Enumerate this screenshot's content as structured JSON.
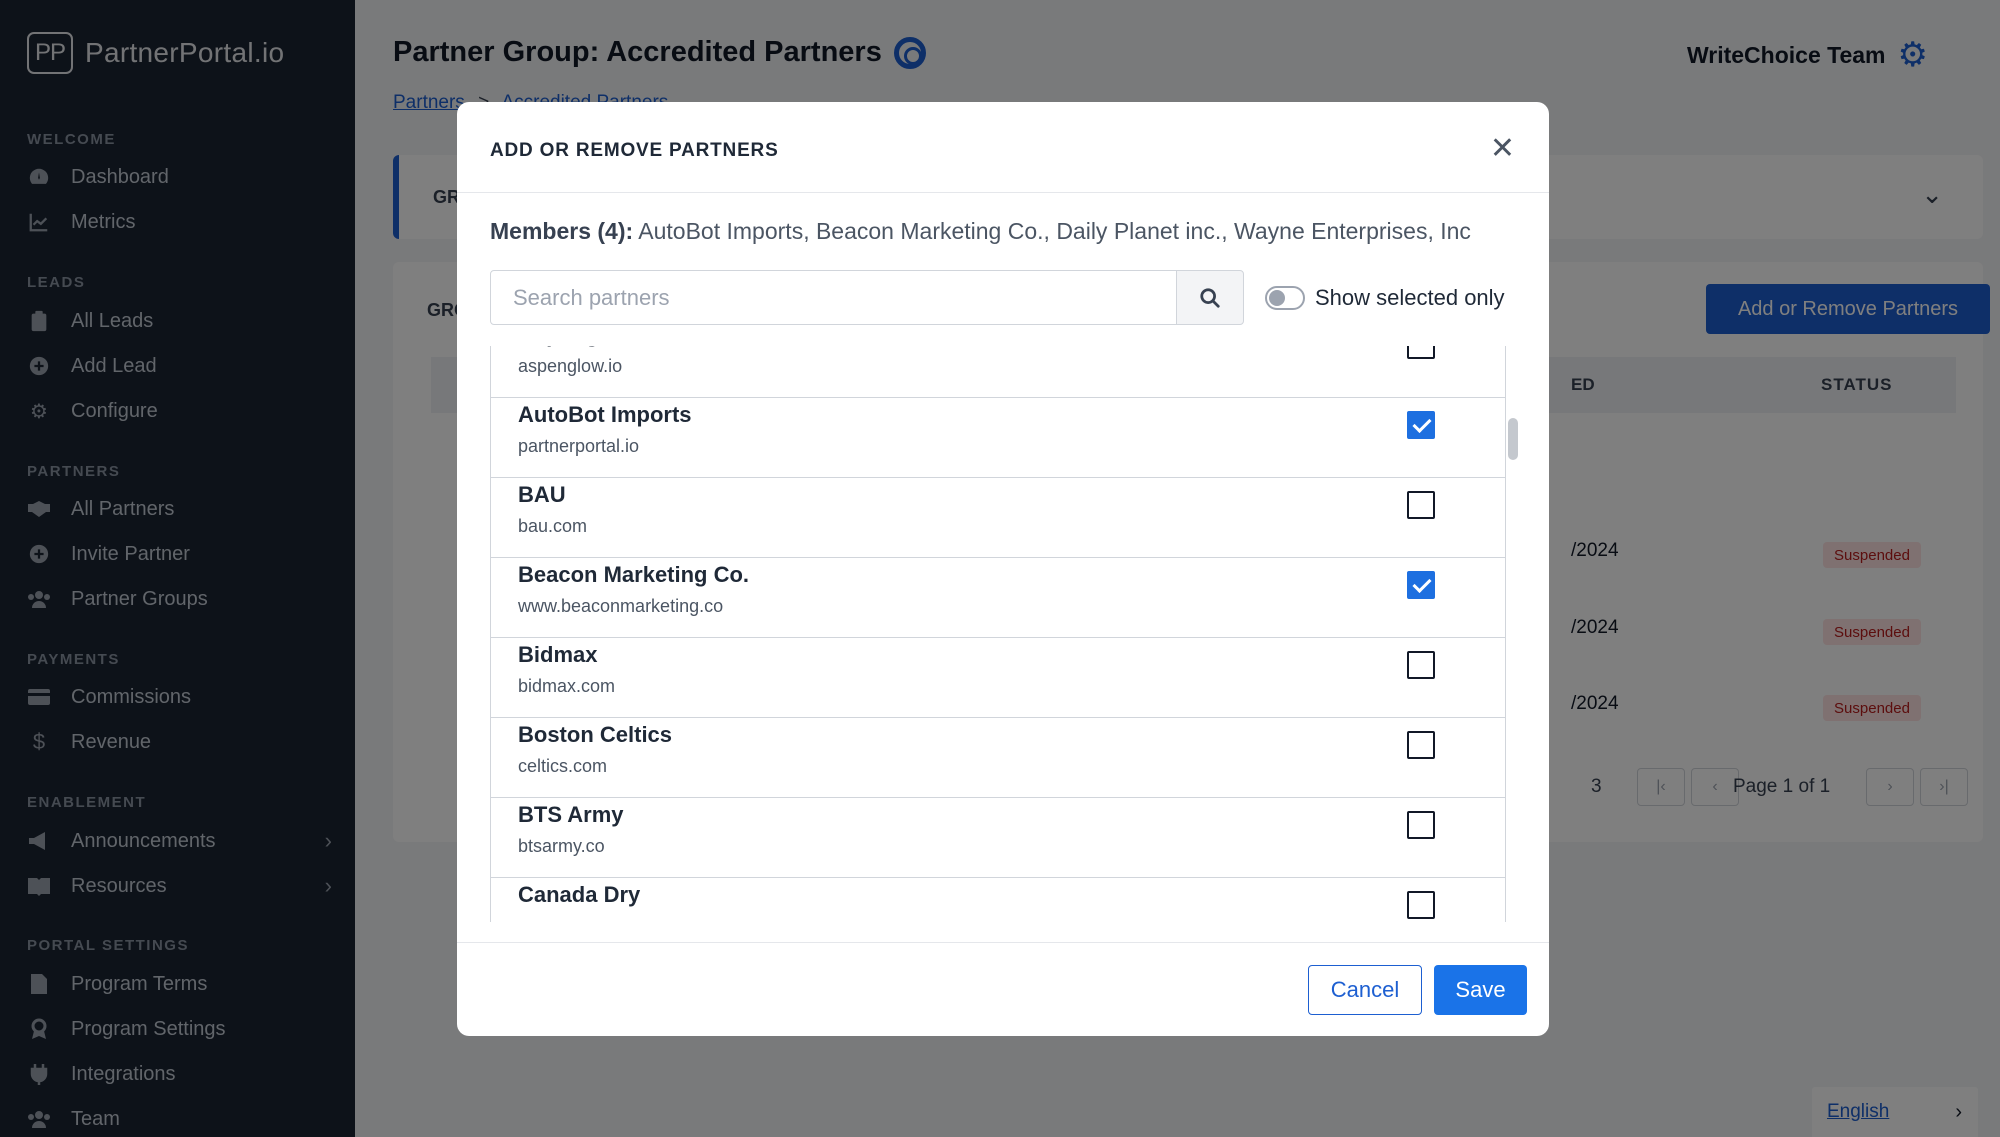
{
  "sidebar": {
    "logo_mark": "PP",
    "logo_text": "PartnerPortal.io",
    "sections": {
      "welcome": "WELCOME",
      "leads": "LEADS",
      "partners": "PARTNERS",
      "payments": "PAYMENTS",
      "enablement": "ENABLEMENT",
      "portal_settings": "PORTAL SETTINGS"
    },
    "items": {
      "dashboard": "Dashboard",
      "metrics": "Metrics",
      "all_leads": "All Leads",
      "add_lead": "Add Lead",
      "configure": "Configure",
      "all_partners": "All Partners",
      "invite_partner": "Invite Partner",
      "partner_groups": "Partner Groups",
      "commissions": "Commissions",
      "revenue": "Revenue",
      "announcements": "Announcements",
      "resources": "Resources",
      "program_terms": "Program Terms",
      "program_settings": "Program Settings",
      "integrations": "Integrations",
      "team": "Team"
    }
  },
  "header": {
    "title": "Partner Group: Accredited Partners",
    "team_name": "WriteChoice Team",
    "breadcrumb": [
      "Partners",
      ">",
      "Accredited Partners"
    ]
  },
  "background": {
    "card1_label": "GR",
    "card2_label": "GRO",
    "add_remove_button": "Add or Remove Partners",
    "column_ed": "ED",
    "column_status": "STATUS",
    "rows": [
      {
        "date": "/2024",
        "status": "Suspended"
      },
      {
        "date": "/2024",
        "status": "Suspended"
      },
      {
        "date": "/2024",
        "status": "Suspended"
      }
    ],
    "pagination": {
      "count": "3",
      "page_text": "Page 1 of 1"
    }
  },
  "modal": {
    "title": "ADD OR REMOVE PARTNERS",
    "members_label": "Members (4):",
    "members_list": "AutoBot Imports, Beacon Marketing Co., Daily Planet inc., Wayne Enterprises, Inc",
    "search_placeholder": "Search partners",
    "toggle_label": "Show selected only",
    "toggle_on": false,
    "partners": [
      {
        "name": "Aspenglow",
        "domain": "aspenglow.io",
        "checked": false
      },
      {
        "name": "AutoBot Imports",
        "domain": "partnerportal.io",
        "checked": true
      },
      {
        "name": "BAU",
        "domain": "bau.com",
        "checked": false
      },
      {
        "name": "Beacon Marketing Co.",
        "domain": "www.beaconmarketing.co",
        "checked": true
      },
      {
        "name": "Bidmax",
        "domain": "bidmax.com",
        "checked": false
      },
      {
        "name": "Boston Celtics",
        "domain": "celtics.com",
        "checked": false
      },
      {
        "name": "BTS Army",
        "domain": "btsarmy.co",
        "checked": false
      },
      {
        "name": "Canada Dry",
        "domain": "",
        "checked": false
      }
    ],
    "cancel_label": "Cancel",
    "save_label": "Save"
  },
  "language": {
    "label": "English"
  },
  "colors": {
    "accent": "#1d5fd1",
    "sidebar_bg": "#1b2432",
    "suspended_bg": "#fee2e2",
    "suspended_text": "#b91c1c"
  }
}
